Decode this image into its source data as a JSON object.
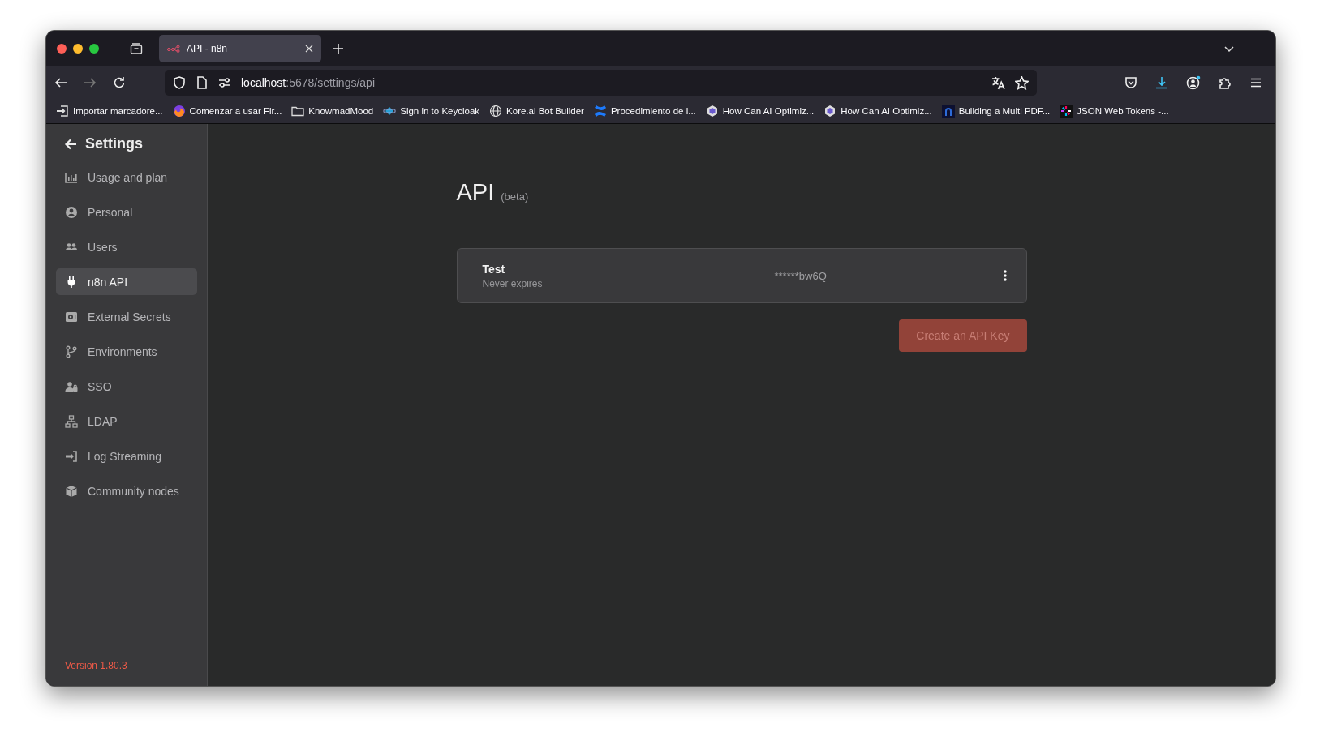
{
  "browser": {
    "tabs": [
      {
        "title": "API - n8n",
        "selected": true
      }
    ],
    "address": {
      "host": "localhost",
      "path": ":5678/settings/api"
    },
    "bookmarks": [
      "Importar marcadore...",
      "Comenzar a usar Fir...",
      "KnowmadMood",
      "Sign in to Keycloak",
      "Kore.ai Bot Builder",
      "Procedimiento de l...",
      "How Can AI Optimiz...",
      "How Can AI Optimiz...",
      "Building a Multi PDF...",
      "JSON Web Tokens -..."
    ]
  },
  "sidebar": {
    "title": "Settings",
    "items": [
      {
        "label": "Usage and plan",
        "selected": false
      },
      {
        "label": "Personal",
        "selected": false
      },
      {
        "label": "Users",
        "selected": false
      },
      {
        "label": "n8n API",
        "selected": true
      },
      {
        "label": "External Secrets",
        "selected": false
      },
      {
        "label": "Environments",
        "selected": false
      },
      {
        "label": "SSO",
        "selected": false
      },
      {
        "label": "LDAP",
        "selected": false
      },
      {
        "label": "Log Streaming",
        "selected": false
      },
      {
        "label": "Community nodes",
        "selected": false
      }
    ],
    "version": "Version 1.80.3"
  },
  "page": {
    "title": "API",
    "badge": "(beta)",
    "api_keys": [
      {
        "name": "Test",
        "expiry": "Never expires",
        "key": "******bw6Q"
      }
    ],
    "create_button": {
      "label": "Create an API Key",
      "disabled": true
    }
  }
}
